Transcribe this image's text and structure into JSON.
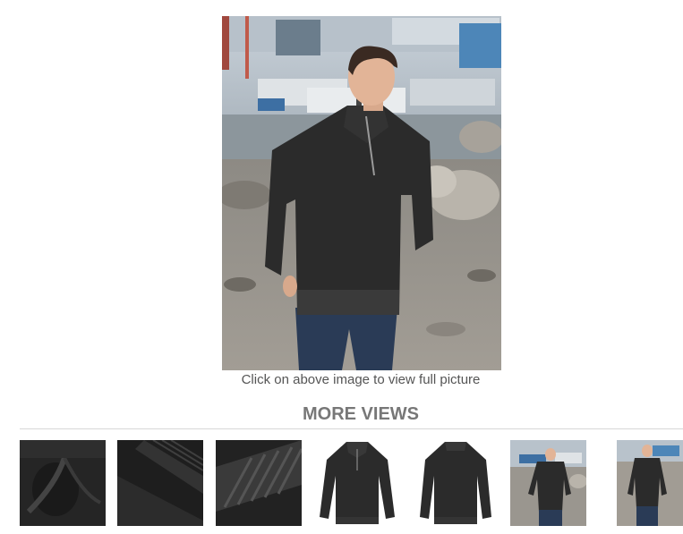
{
  "main_image": {
    "alt": "Man wearing a charcoal quarter-zip knit sweater and jeans on a rocky waterfront"
  },
  "caption": "Click on above image to view full picture",
  "more_views": {
    "title": "MORE VIEWS",
    "thumbnails": [
      {
        "alt": "Sweater fabric close-up with zipper"
      },
      {
        "alt": "Sweater ribbed cuff close-up"
      },
      {
        "alt": "Sweater ribbed hem close-up"
      },
      {
        "alt": "Sweater front view"
      },
      {
        "alt": "Sweater back view"
      },
      {
        "alt": "Model wearing sweater on beach"
      },
      {
        "alt": "Model wearing sweater standing"
      }
    ]
  },
  "colors": {
    "sweater": "#2b2b2b",
    "caption_text": "#555555",
    "title_text": "#777777",
    "divider": "#d6d6d6"
  }
}
